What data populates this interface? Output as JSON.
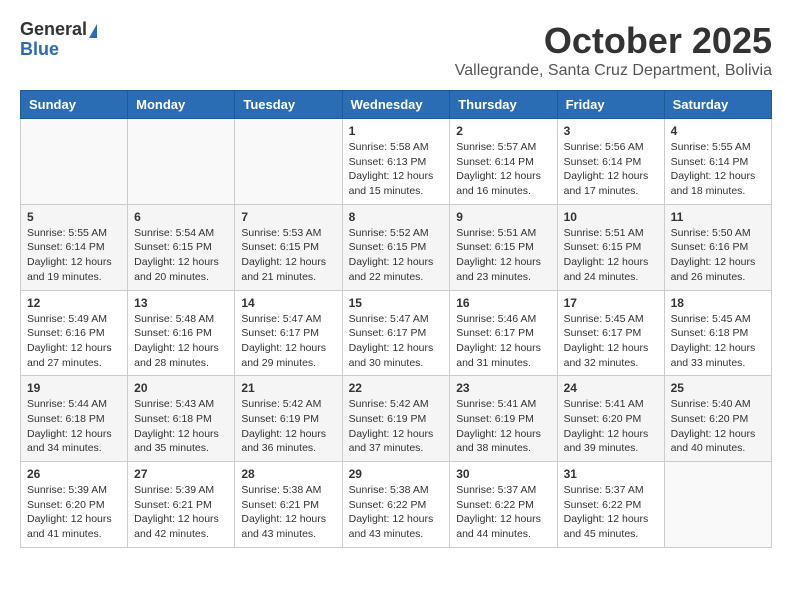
{
  "header": {
    "logo_general": "General",
    "logo_blue": "Blue",
    "month_title": "October 2025",
    "location": "Vallegrande, Santa Cruz Department, Bolivia"
  },
  "days_of_week": [
    "Sunday",
    "Monday",
    "Tuesday",
    "Wednesday",
    "Thursday",
    "Friday",
    "Saturday"
  ],
  "weeks": [
    [
      {
        "day": "",
        "info": ""
      },
      {
        "day": "",
        "info": ""
      },
      {
        "day": "",
        "info": ""
      },
      {
        "day": "1",
        "info": "Sunrise: 5:58 AM\nSunset: 6:13 PM\nDaylight: 12 hours\nand 15 minutes."
      },
      {
        "day": "2",
        "info": "Sunrise: 5:57 AM\nSunset: 6:14 PM\nDaylight: 12 hours\nand 16 minutes."
      },
      {
        "day": "3",
        "info": "Sunrise: 5:56 AM\nSunset: 6:14 PM\nDaylight: 12 hours\nand 17 minutes."
      },
      {
        "day": "4",
        "info": "Sunrise: 5:55 AM\nSunset: 6:14 PM\nDaylight: 12 hours\nand 18 minutes."
      }
    ],
    [
      {
        "day": "5",
        "info": "Sunrise: 5:55 AM\nSunset: 6:14 PM\nDaylight: 12 hours\nand 19 minutes."
      },
      {
        "day": "6",
        "info": "Sunrise: 5:54 AM\nSunset: 6:15 PM\nDaylight: 12 hours\nand 20 minutes."
      },
      {
        "day": "7",
        "info": "Sunrise: 5:53 AM\nSunset: 6:15 PM\nDaylight: 12 hours\nand 21 minutes."
      },
      {
        "day": "8",
        "info": "Sunrise: 5:52 AM\nSunset: 6:15 PM\nDaylight: 12 hours\nand 22 minutes."
      },
      {
        "day": "9",
        "info": "Sunrise: 5:51 AM\nSunset: 6:15 PM\nDaylight: 12 hours\nand 23 minutes."
      },
      {
        "day": "10",
        "info": "Sunrise: 5:51 AM\nSunset: 6:15 PM\nDaylight: 12 hours\nand 24 minutes."
      },
      {
        "day": "11",
        "info": "Sunrise: 5:50 AM\nSunset: 6:16 PM\nDaylight: 12 hours\nand 26 minutes."
      }
    ],
    [
      {
        "day": "12",
        "info": "Sunrise: 5:49 AM\nSunset: 6:16 PM\nDaylight: 12 hours\nand 27 minutes."
      },
      {
        "day": "13",
        "info": "Sunrise: 5:48 AM\nSunset: 6:16 PM\nDaylight: 12 hours\nand 28 minutes."
      },
      {
        "day": "14",
        "info": "Sunrise: 5:47 AM\nSunset: 6:17 PM\nDaylight: 12 hours\nand 29 minutes."
      },
      {
        "day": "15",
        "info": "Sunrise: 5:47 AM\nSunset: 6:17 PM\nDaylight: 12 hours\nand 30 minutes."
      },
      {
        "day": "16",
        "info": "Sunrise: 5:46 AM\nSunset: 6:17 PM\nDaylight: 12 hours\nand 31 minutes."
      },
      {
        "day": "17",
        "info": "Sunrise: 5:45 AM\nSunset: 6:17 PM\nDaylight: 12 hours\nand 32 minutes."
      },
      {
        "day": "18",
        "info": "Sunrise: 5:45 AM\nSunset: 6:18 PM\nDaylight: 12 hours\nand 33 minutes."
      }
    ],
    [
      {
        "day": "19",
        "info": "Sunrise: 5:44 AM\nSunset: 6:18 PM\nDaylight: 12 hours\nand 34 minutes."
      },
      {
        "day": "20",
        "info": "Sunrise: 5:43 AM\nSunset: 6:18 PM\nDaylight: 12 hours\nand 35 minutes."
      },
      {
        "day": "21",
        "info": "Sunrise: 5:42 AM\nSunset: 6:19 PM\nDaylight: 12 hours\nand 36 minutes."
      },
      {
        "day": "22",
        "info": "Sunrise: 5:42 AM\nSunset: 6:19 PM\nDaylight: 12 hours\nand 37 minutes."
      },
      {
        "day": "23",
        "info": "Sunrise: 5:41 AM\nSunset: 6:19 PM\nDaylight: 12 hours\nand 38 minutes."
      },
      {
        "day": "24",
        "info": "Sunrise: 5:41 AM\nSunset: 6:20 PM\nDaylight: 12 hours\nand 39 minutes."
      },
      {
        "day": "25",
        "info": "Sunrise: 5:40 AM\nSunset: 6:20 PM\nDaylight: 12 hours\nand 40 minutes."
      }
    ],
    [
      {
        "day": "26",
        "info": "Sunrise: 5:39 AM\nSunset: 6:20 PM\nDaylight: 12 hours\nand 41 minutes."
      },
      {
        "day": "27",
        "info": "Sunrise: 5:39 AM\nSunset: 6:21 PM\nDaylight: 12 hours\nand 42 minutes."
      },
      {
        "day": "28",
        "info": "Sunrise: 5:38 AM\nSunset: 6:21 PM\nDaylight: 12 hours\nand 43 minutes."
      },
      {
        "day": "29",
        "info": "Sunrise: 5:38 AM\nSunset: 6:22 PM\nDaylight: 12 hours\nand 43 minutes."
      },
      {
        "day": "30",
        "info": "Sunrise: 5:37 AM\nSunset: 6:22 PM\nDaylight: 12 hours\nand 44 minutes."
      },
      {
        "day": "31",
        "info": "Sunrise: 5:37 AM\nSunset: 6:22 PM\nDaylight: 12 hours\nand 45 minutes."
      },
      {
        "day": "",
        "info": ""
      }
    ]
  ]
}
